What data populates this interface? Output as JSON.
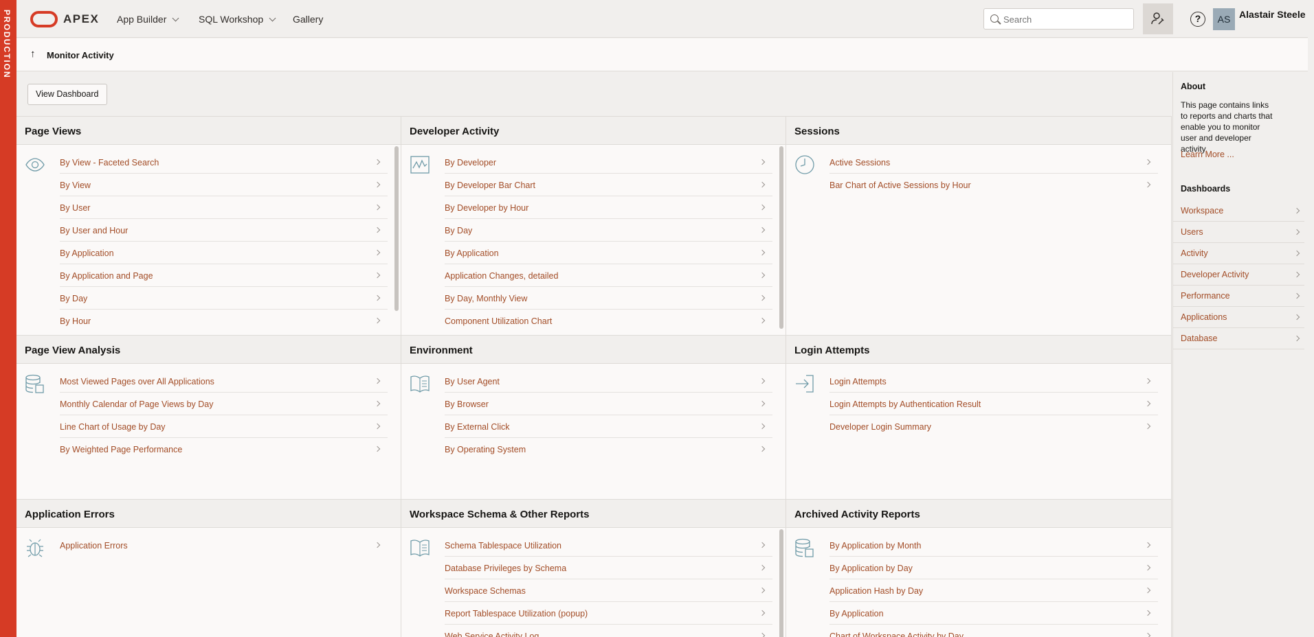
{
  "env_label": "PRODUCTION",
  "header": {
    "brand": "APEX",
    "nav": [
      "App Builder",
      "SQL Workshop",
      "Gallery"
    ],
    "search_placeholder": "Search",
    "avatar_initials": "AS",
    "user_name": "Alastair Steele"
  },
  "breadcrumb": {
    "arrow": "↑",
    "title": "Monitor Activity"
  },
  "toolbar": {
    "view_dashboard": "View Dashboard"
  },
  "regions": {
    "page_views": {
      "title": "Page Views",
      "links": [
        "By View - Faceted Search",
        "By View",
        "By User",
        "By User and Hour",
        "By Application",
        "By Application and Page",
        "By Day",
        "By Hour"
      ]
    },
    "developer_activity": {
      "title": "Developer Activity",
      "links": [
        "By Developer",
        "By Developer Bar Chart",
        "By Developer by Hour",
        "By Day",
        "By Application",
        "Application Changes, detailed",
        "By Day, Monthly View",
        "Component Utilization Chart"
      ]
    },
    "sessions": {
      "title": "Sessions",
      "links": [
        "Active Sessions",
        "Bar Chart of Active Sessions by Hour"
      ]
    },
    "page_view_analysis": {
      "title": "Page View Analysis",
      "links": [
        "Most Viewed Pages over All Applications",
        "Monthly Calendar of Page Views by Day",
        "Line Chart of Usage by Day",
        "By Weighted Page Performance"
      ]
    },
    "environment": {
      "title": "Environment",
      "links": [
        "By User Agent",
        "By Browser",
        "By External Click",
        "By Operating System"
      ]
    },
    "login_attempts": {
      "title": "Login Attempts",
      "links": [
        "Login Attempts",
        "Login Attempts by Authentication Result",
        "Developer Login Summary"
      ]
    },
    "application_errors": {
      "title": "Application Errors",
      "links": [
        "Application Errors"
      ]
    },
    "workspace_schema": {
      "title": "Workspace Schema & Other Reports",
      "links": [
        "Schema Tablespace Utilization",
        "Database Privileges by Schema",
        "Workspace Schemas",
        "Report Tablespace Utilization (popup)",
        "Web Service Activity Log"
      ]
    },
    "archived": {
      "title": "Archived Activity Reports",
      "links": [
        "By Application by Month",
        "By Application by Day",
        "Application Hash by Day",
        "By Application",
        "Chart of Workspace Activity by Day"
      ]
    }
  },
  "sidebar": {
    "about_title": "About",
    "about_text": "This page contains links to reports and charts that enable you to monitor user and developer activity.",
    "learn_more": "Learn More ...",
    "dashboards_title": "Dashboards",
    "dashboards": [
      "Workspace",
      "Users",
      "Activity",
      "Developer Activity",
      "Performance",
      "Applications",
      "Database"
    ]
  },
  "colors": {
    "env": "#d63b25",
    "link": "#a24c26",
    "icon": "#6f9ba8"
  }
}
